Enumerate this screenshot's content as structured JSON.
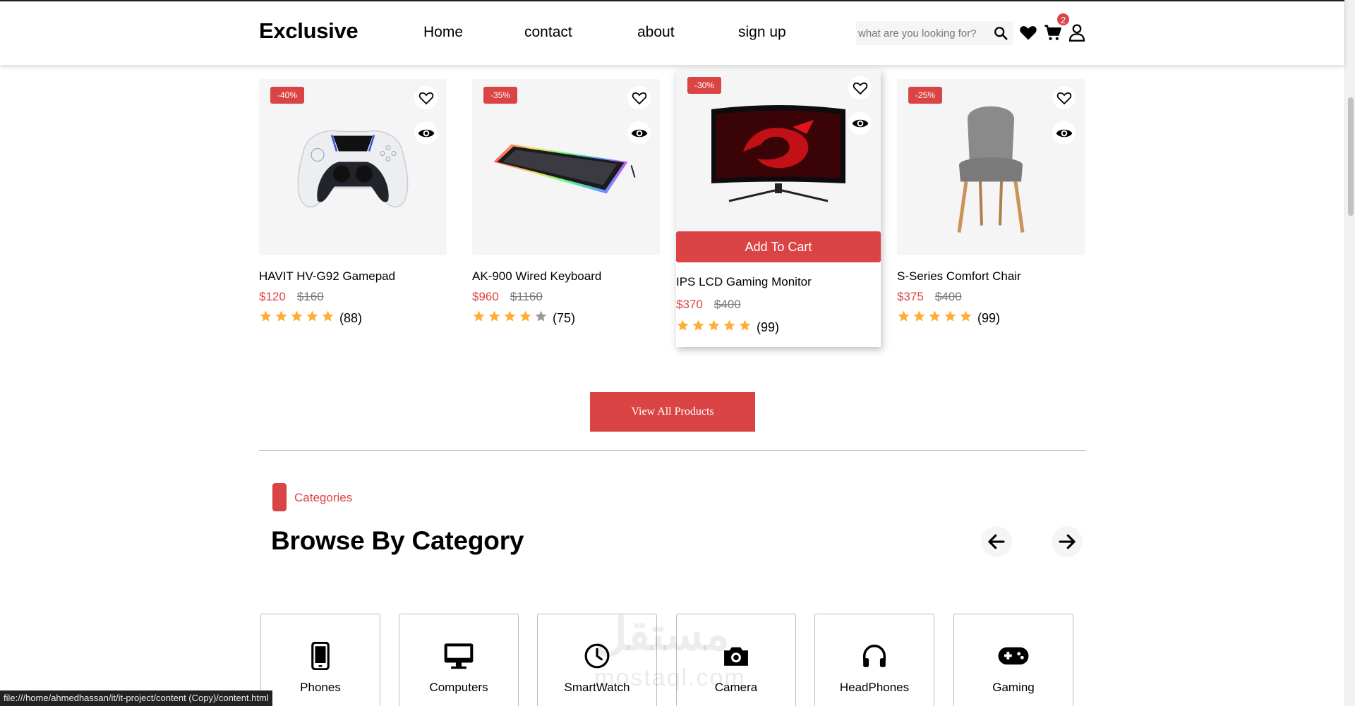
{
  "header": {
    "logo": "Exclusive",
    "nav": [
      "Home",
      "contact",
      "about",
      "sign up"
    ],
    "search_placeholder": "what are you looking for?",
    "cart_count": "2"
  },
  "products": [
    {
      "discount": "-40%",
      "name": "HAVIT HV-G92 Gamepad",
      "price": "$120",
      "old_price": "$160",
      "rating": 5,
      "reviews": "(88)"
    },
    {
      "discount": "-35%",
      "name": "AK-900 Wired Keyboard",
      "price": "$960",
      "old_price": "$1160",
      "rating": 4,
      "reviews": "(75)"
    },
    {
      "discount": "-30%",
      "name": "IPS LCD Gaming Monitor",
      "price": "$370",
      "old_price": "$400",
      "rating": 5,
      "reviews": "(99)",
      "add_to_cart": "Add To Cart"
    },
    {
      "discount": "-25%",
      "name": "S-Series Comfort Chair",
      "price": "$375",
      "old_price": "$400",
      "rating": 5,
      "reviews": "(99)"
    }
  ],
  "view_all_label": "View All Products",
  "categories_section": {
    "tag": "Categories",
    "title": "Browse By Category",
    "items": [
      "Phones",
      "Computers",
      "SmartWatch",
      "Camera",
      "HeadPhones",
      "Gaming"
    ]
  },
  "watermark": {
    "arabic": "مستقل",
    "latin": "mostaql.com"
  },
  "status_url": "file:///home/ahmedhassan/it/it-project/content (Copy)/content.html",
  "colors": {
    "accent": "#db4444",
    "star": "#ffad33",
    "star_empty": "#999999"
  }
}
